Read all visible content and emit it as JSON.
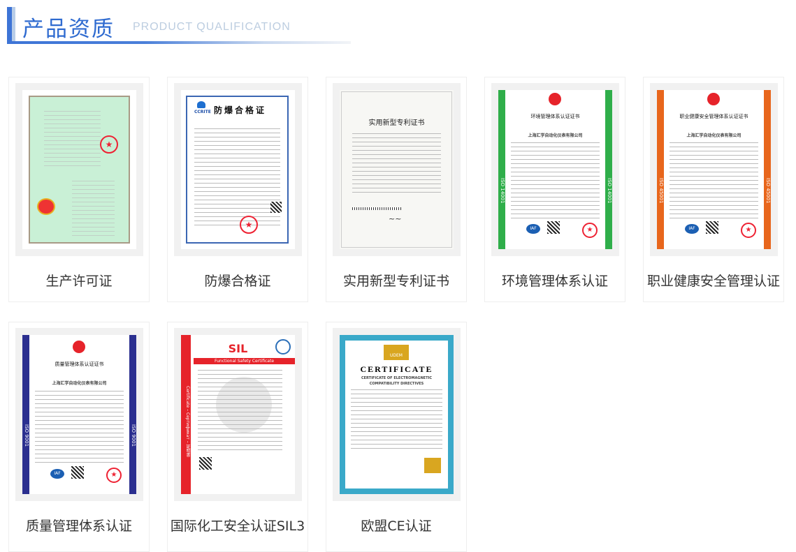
{
  "header": {
    "title": "产品资质",
    "subtitle": "PRODUCT QUALIFICATION"
  },
  "colors": {
    "accent": "#3d74d6",
    "green": "#2fae4a",
    "orange": "#e8661c",
    "navy": "#2b2f8f",
    "red": "#e6232a",
    "teal": "#3aa9c9"
  },
  "items": [
    {
      "label": "生产许可证",
      "cert_title": ""
    },
    {
      "label": "防爆合格证",
      "cert_title": "防爆合格证",
      "logo": "CCRITE"
    },
    {
      "label": "实用新型专利证书",
      "cert_title": "实用新型专利证书"
    },
    {
      "label": "环境管理体系认证",
      "cert_title": "环境管理体系认证证书",
      "side": "ISO 14001",
      "company": "上海汇学自动化仪表有限公司"
    },
    {
      "label": "职业健康安全管理认证",
      "cert_title": "职业健康安全管理体系认证证书",
      "side": "ISO 45001",
      "company": "上海汇学自动化仪表有限公司"
    },
    {
      "label": "质量管理体系认证",
      "cert_title": "质量管理体系认证证书",
      "side": "ISO 9001",
      "company": "上海汇学自动化仪表有限公司"
    },
    {
      "label": "国际化工安全认证SIL3",
      "cert_title": "SIL",
      "cert_sub": "Functional Safety Certificate",
      "side": "Certificate – Сертификат – 証明書"
    },
    {
      "label": "欧盟CE认证",
      "cert_title": "CERTIFICATE",
      "cert_sub": "CERTIFICATE OF ELECTROMAGNETIC COMPATIBILITY DIRECTIVES",
      "logo": "UDEM"
    }
  ]
}
